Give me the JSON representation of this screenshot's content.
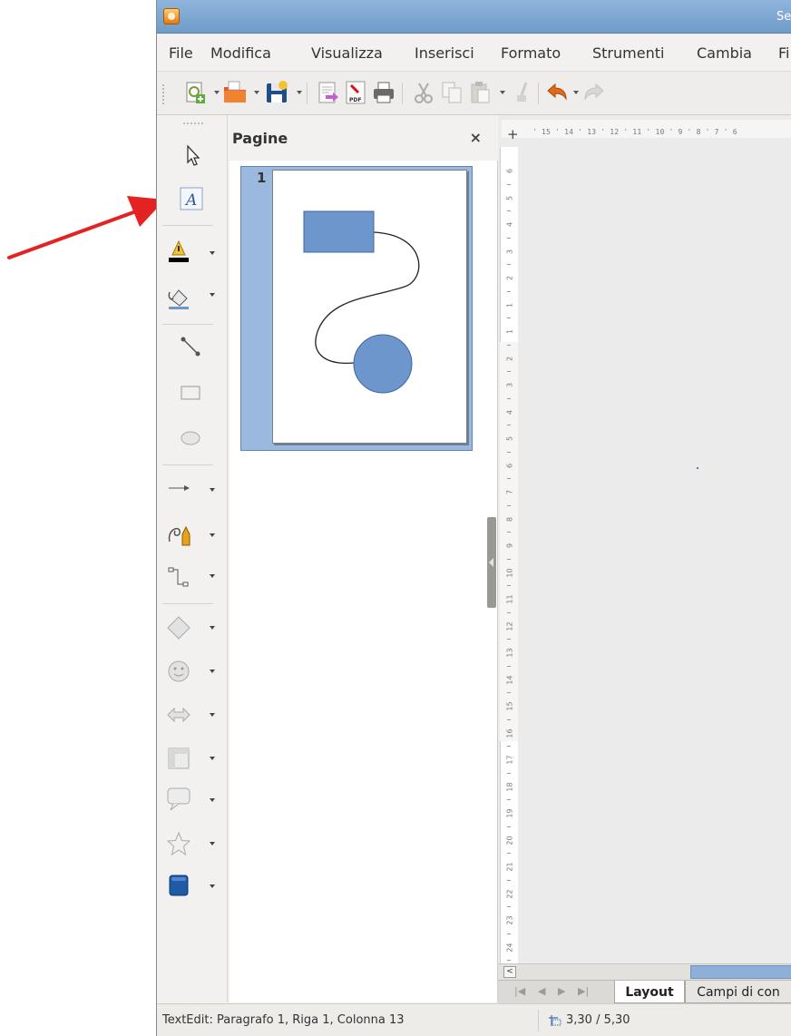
{
  "window": {
    "title": "Se"
  },
  "menu": {
    "items": [
      "File",
      "Modifica",
      "Visualizza",
      "Inserisci",
      "Formato",
      "Strumenti",
      "Cambia",
      "Fi"
    ]
  },
  "toolbar": {
    "buttons": [
      {
        "name": "new-document-icon",
        "has_dropdown": true
      },
      {
        "name": "open-folder-icon",
        "has_dropdown": true
      },
      {
        "name": "save-icon",
        "has_dropdown": true
      },
      {
        "name": "edit-file-icon",
        "has_dropdown": false
      },
      {
        "name": "export-pdf-icon",
        "has_dropdown": false,
        "label": "PDF"
      },
      {
        "name": "print-icon",
        "has_dropdown": false
      },
      {
        "name": "cut-icon",
        "has_dropdown": false
      },
      {
        "name": "copy-icon",
        "has_dropdown": false
      },
      {
        "name": "paste-icon",
        "has_dropdown": true
      },
      {
        "name": "clone-formatting-icon",
        "has_dropdown": false
      },
      {
        "name": "undo-icon",
        "has_dropdown": true
      },
      {
        "name": "redo-icon",
        "has_dropdown": false
      }
    ]
  },
  "drawing_toolbar": {
    "tools": [
      {
        "name": "select-pointer-icon",
        "has_dropdown": false
      },
      {
        "name": "text-tool-icon",
        "has_dropdown": false,
        "label": "A",
        "highlighted_by_arrow": true
      },
      {
        "name": "line-color-icon",
        "has_dropdown": true
      },
      {
        "name": "fill-color-icon",
        "has_dropdown": true
      },
      {
        "name": "line-tool-icon",
        "has_dropdown": false
      },
      {
        "name": "rectangle-tool-icon",
        "has_dropdown": false
      },
      {
        "name": "ellipse-tool-icon",
        "has_dropdown": false
      },
      {
        "name": "arrow-line-icon",
        "has_dropdown": true
      },
      {
        "name": "curve-tool-icon",
        "has_dropdown": true
      },
      {
        "name": "connector-tool-icon",
        "has_dropdown": true
      },
      {
        "name": "basic-shapes-icon",
        "has_dropdown": true
      },
      {
        "name": "symbol-shapes-icon",
        "has_dropdown": true
      },
      {
        "name": "block-arrows-icon",
        "has_dropdown": true
      },
      {
        "name": "flowchart-icon",
        "has_dropdown": true
      },
      {
        "name": "callouts-icon",
        "has_dropdown": true
      },
      {
        "name": "stars-icon",
        "has_dropdown": true
      },
      {
        "name": "3d-objects-icon",
        "has_dropdown": true
      }
    ]
  },
  "pages_pane": {
    "title": "Pagine",
    "close_label": "×",
    "pages": [
      {
        "number": "1"
      }
    ]
  },
  "ruler": {
    "origin": "+",
    "horizontal_ticks": "' 15 ' 14 ' 13 ' 12 ' 11 ' 10 ' 9 ' 8 ' 7 ' 6",
    "vertical_numbers": [
      "6",
      "5",
      "4",
      "3",
      "2",
      "1",
      "1",
      "2",
      "3",
      "4",
      "5",
      "6",
      "7",
      "8",
      "9",
      "10",
      "11",
      "12",
      "13",
      "14",
      "15",
      "16",
      "17",
      "18",
      "19",
      "20",
      "21",
      "22",
      "23",
      "24"
    ]
  },
  "tabs": {
    "items": [
      {
        "label": "Layout",
        "active": true
      },
      {
        "label": "Campi di con",
        "active": false
      }
    ]
  },
  "status": {
    "text": "TextEdit: Paragrafo 1, Riga 1, Colonna 13",
    "position": "3,30 / 5,30"
  },
  "colors": {
    "shape_fill": "#6d96cc",
    "shape_stroke": "#3c679e",
    "selection": "#9bb9de",
    "annotation_arrow": "#e52222"
  }
}
